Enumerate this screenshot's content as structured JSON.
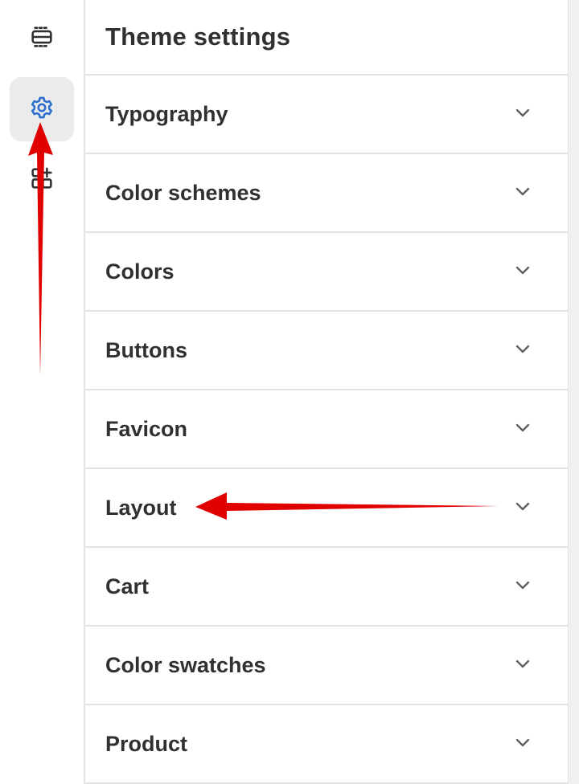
{
  "sidebar": {
    "items": [
      {
        "icon": "sections-icon",
        "active": false
      },
      {
        "icon": "gear-icon",
        "active": true,
        "color": "#2c6ecb"
      },
      {
        "icon": "apps-icon",
        "active": false
      }
    ]
  },
  "panel": {
    "title": "Theme settings",
    "sections": [
      {
        "label": "Typography"
      },
      {
        "label": "Color schemes"
      },
      {
        "label": "Colors"
      },
      {
        "label": "Buttons"
      },
      {
        "label": "Favicon"
      },
      {
        "label": "Layout"
      },
      {
        "label": "Cart"
      },
      {
        "label": "Color swatches"
      },
      {
        "label": "Product"
      }
    ]
  },
  "annotations": {
    "arrow_color": "#e00000"
  }
}
